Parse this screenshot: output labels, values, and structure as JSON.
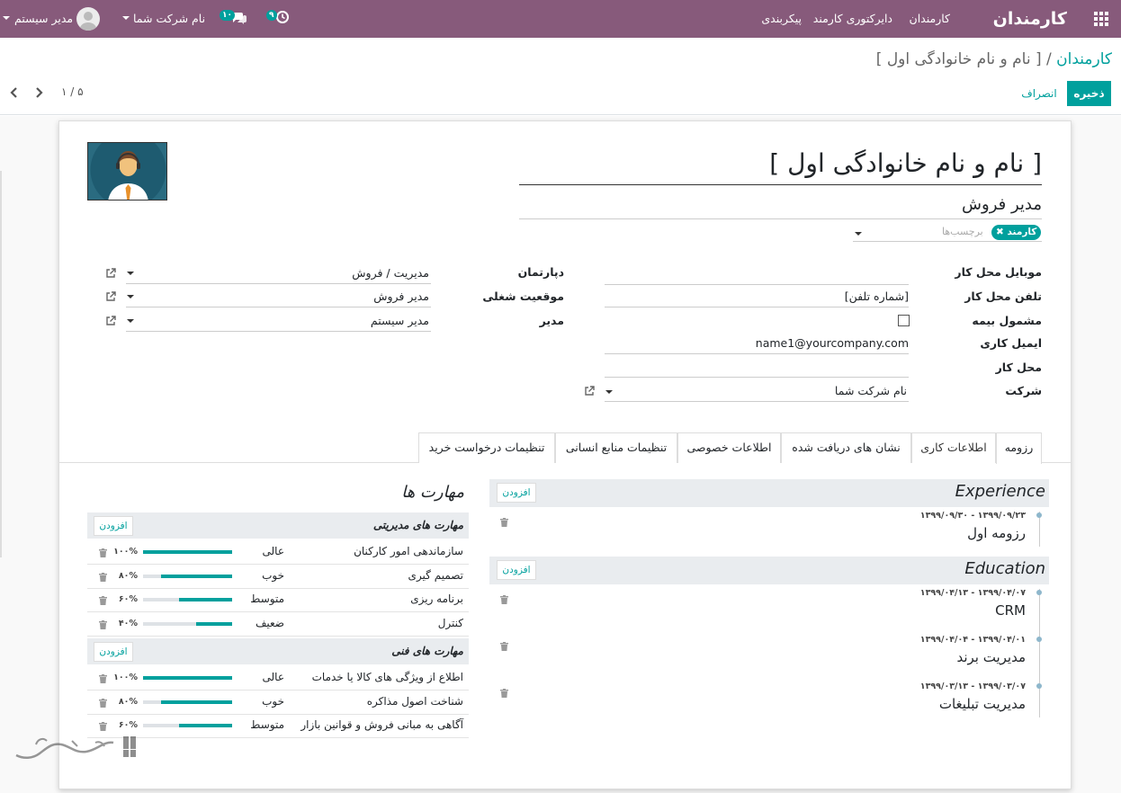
{
  "topbar": {
    "app_title": "کارمندان",
    "menu": [
      "کارمندان",
      "دایرکتوری کارمند",
      "پیکربندی"
    ],
    "user_name": "مدیر سیستم",
    "company": "نام شرکت شما",
    "messages_count": "۱۰",
    "activities_count": "۹",
    "bg_color": "#875a7b"
  },
  "breadcrumb": {
    "parent": "کارمندان",
    "separator": "/",
    "current": "[ نام و نام خانوادگی اول ]"
  },
  "actions": {
    "save": "ذخیره",
    "discard": "انصراف"
  },
  "pager": {
    "value": "۱ / ۵"
  },
  "employee": {
    "name": "[ نام و نام خانوادگی اول ]",
    "job_title": "مدیر فروش",
    "tag": "کارمند",
    "tags_placeholder": "برچسب‌ها"
  },
  "left_fields": {
    "mobile_label": "موبایل محل کار",
    "phone_label": "تلفن محل کار",
    "phone_value": "[شماره تلفن]",
    "insurance_label": "مشمول بیمه",
    "email_label": "ایمیل کاری",
    "email_value": "name1@yourcompany.com",
    "location_label": "محل کار",
    "company_label": "شرکت",
    "company_value": "نام شرکت شما"
  },
  "right_fields": {
    "department_label": "دپارتمان",
    "department_value": "مدیریت / فروش",
    "job_label": "موقعیت شغلی",
    "job_value": "مدیر فروش",
    "manager_label": "مدیر",
    "manager_value": "مدیر سیستم"
  },
  "tabs": [
    "رزومه",
    "اطلاعات کاری",
    "نشان های دریافت شده",
    "اطلاعات خصوصی",
    "تنظیمات منابع انسانی",
    "تنظیمات درخواست خرید"
  ],
  "resume": {
    "add_label": "افزودن",
    "sections": [
      {
        "title": "Experience",
        "items": [
          {
            "dates": "۱۳۹۹/۰۹/۲۳ - ۱۳۹۹/۰۹/۳۰",
            "name": "رزومه اول"
          }
        ]
      },
      {
        "title": "Education",
        "items": [
          {
            "dates": "۱۳۹۹/۰۴/۰۷ - ۱۳۹۹/۰۴/۱۳",
            "name": "CRM"
          },
          {
            "dates": "۱۳۹۹/۰۴/۰۱ - ۱۳۹۹/۰۴/۰۴",
            "name": "مدیریت برند"
          },
          {
            "dates": "۱۳۹۹/۰۳/۰۷ - ۱۳۹۹/۰۳/۱۳",
            "name": "مدیریت تبلیغات"
          }
        ]
      }
    ]
  },
  "skills": {
    "title": "مهارت ها",
    "add_label": "افزودن",
    "groups": [
      {
        "name": "مهارت های مدیریتی",
        "items": [
          {
            "name": "سازماندهی امور کارکنان",
            "level": "عالی",
            "percent": 100,
            "pct_label": "۱۰۰%"
          },
          {
            "name": "تصمیم گیری",
            "level": "خوب",
            "percent": 80,
            "pct_label": "۸۰%"
          },
          {
            "name": "برنامه ریزی",
            "level": "متوسط",
            "percent": 60,
            "pct_label": "۶۰%"
          },
          {
            "name": "کنترل",
            "level": "ضعیف",
            "percent": 40,
            "pct_label": "۴۰%"
          }
        ]
      },
      {
        "name": "مهارت های فنی",
        "items": [
          {
            "name": "اطلاع از ویژگی های کالا یا خدمات",
            "level": "عالی",
            "percent": 100,
            "pct_label": "۱۰۰%"
          },
          {
            "name": "شناخت اصول مذاکره",
            "level": "خوب",
            "percent": 80,
            "pct_label": "۸۰%"
          },
          {
            "name": "آگاهی به مبانی فروش و قوانین بازار",
            "level": "متوسط",
            "percent": 60,
            "pct_label": "۶۰%"
          }
        ]
      }
    ]
  },
  "colors": {
    "accent": "#00a09d",
    "primary": "#875a7b",
    "tag_bg": "#00a09d"
  }
}
